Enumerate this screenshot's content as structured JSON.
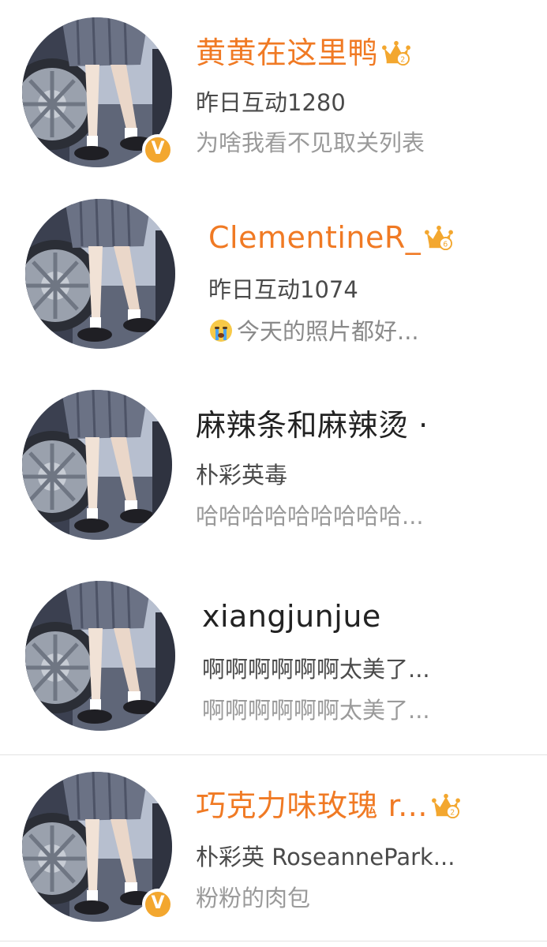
{
  "colors": {
    "vip_name": "#f07a24",
    "normal_name": "#222222",
    "badge": "#f3a72f"
  },
  "users": [
    {
      "name": "黄黄在这里鸭",
      "subtitle": "昨日互动1280",
      "detail": "为啥我看不见取关列表",
      "vip": true,
      "crown_level": "2",
      "verified": true
    },
    {
      "name": "ClementineR_",
      "subtitle": "昨日互动1074",
      "detail": "今天的照片都好...",
      "detail_emoji": "crying-face-icon",
      "vip": true,
      "crown_level": "6",
      "verified": false
    },
    {
      "name": "麻辣条和麻辣烫 ·",
      "subtitle": "朴彩英毒",
      "detail": "哈哈哈哈哈哈哈哈哈...",
      "vip": false,
      "verified": false
    },
    {
      "name": "xiangjunjue",
      "subtitle": "啊啊啊啊啊啊太美了...",
      "detail": "啊啊啊啊啊啊太美了...",
      "vip": false,
      "verified": false
    },
    {
      "name": "巧克力味玫瑰 r...",
      "subtitle": "朴彩英 RoseannePark...",
      "detail": "粉粉的肉包",
      "vip": true,
      "crown_level": "2",
      "verified": true
    }
  ],
  "badge_letter": "V"
}
